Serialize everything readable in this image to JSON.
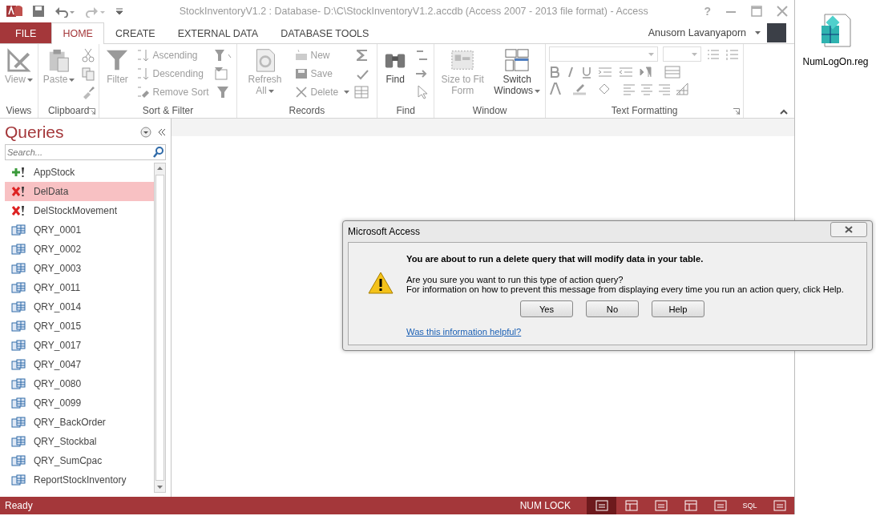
{
  "window": {
    "title": "StockInventoryV1.2 : Database- D:\\C\\StockInventoryV1.2.accdb (Access 2007 - 2013 file format) - Access",
    "help": "?"
  },
  "tabs": [
    {
      "label": "FILE",
      "kind": "file",
      "selected": false
    },
    {
      "label": "HOME",
      "kind": "tab",
      "selected": true
    },
    {
      "label": "CREATE",
      "kind": "tab",
      "selected": false
    },
    {
      "label": "EXTERNAL DATA",
      "kind": "tab",
      "selected": false
    },
    {
      "label": "DATABASE TOOLS",
      "kind": "tab",
      "selected": false
    }
  ],
  "user": {
    "name": "Anusorn Lavanyaporn"
  },
  "ribbon_groups": [
    {
      "label": "Views",
      "launcher": false,
      "commands": [
        {
          "label": "View",
          "kind": "large",
          "caret": true,
          "disabled": true
        }
      ]
    },
    {
      "label": "Clipboard",
      "launcher": true,
      "commands": [
        {
          "label": "Paste",
          "kind": "large",
          "caret": true,
          "disabled": true
        }
      ]
    },
    {
      "label": "Sort & Filter",
      "launcher": false,
      "commands": [
        {
          "label": "Filter",
          "kind": "large",
          "caret": false,
          "disabled": true
        },
        {
          "label": "Ascending",
          "kind": "small",
          "caret": false,
          "disabled": true
        },
        {
          "label": "Descending",
          "kind": "small",
          "caret": false,
          "disabled": true
        },
        {
          "label": "Remove Sort",
          "kind": "small",
          "caret": false,
          "disabled": true
        }
      ]
    },
    {
      "label": "Records",
      "launcher": false,
      "commands": [
        {
          "label": "Refresh All",
          "kind": "large",
          "caret": true,
          "disabled": true
        },
        {
          "label": "New",
          "kind": "small",
          "caret": false,
          "disabled": true
        },
        {
          "label": "Save",
          "kind": "small",
          "caret": false,
          "disabled": true
        },
        {
          "label": "Delete",
          "kind": "small",
          "caret": true,
          "disabled": true
        }
      ]
    },
    {
      "label": "Find",
      "launcher": false,
      "commands": [
        {
          "label": "Find",
          "kind": "large",
          "caret": false,
          "disabled": false
        }
      ]
    },
    {
      "label": "Window",
      "launcher": false,
      "commands": [
        {
          "label": "Size to Fit Form",
          "kind": "large",
          "caret": false,
          "disabled": true
        },
        {
          "label": "Switch Windows",
          "kind": "large",
          "caret": true,
          "disabled": false
        }
      ]
    },
    {
      "label": "Text Formatting",
      "launcher": true
    }
  ],
  "nav": {
    "title": "Queries",
    "search": {
      "placeholder": "Search..."
    },
    "items": [
      {
        "label": "AppStock",
        "kind": "append",
        "selected": false
      },
      {
        "label": "DelData",
        "kind": "delete",
        "selected": true
      },
      {
        "label": "DelStockMovement",
        "kind": "delete",
        "selected": false
      },
      {
        "label": "QRY_0001",
        "kind": "select",
        "selected": false
      },
      {
        "label": "QRY_0002",
        "kind": "select",
        "selected": false
      },
      {
        "label": "QRY_0003",
        "kind": "select",
        "selected": false
      },
      {
        "label": "QRY_0011",
        "kind": "select",
        "selected": false
      },
      {
        "label": "QRY_0014",
        "kind": "select",
        "selected": false
      },
      {
        "label": "QRY_0015",
        "kind": "select",
        "selected": false
      },
      {
        "label": "QRY_0017",
        "kind": "select",
        "selected": false
      },
      {
        "label": "QRY_0047",
        "kind": "select",
        "selected": false
      },
      {
        "label": "QRY_0080",
        "kind": "select",
        "selected": false
      },
      {
        "label": "QRY_0099",
        "kind": "select",
        "selected": false
      },
      {
        "label": "QRY_BackOrder",
        "kind": "select",
        "selected": false
      },
      {
        "label": "QRY_Stockbal",
        "kind": "select",
        "selected": false
      },
      {
        "label": "QRY_SumCpac",
        "kind": "select",
        "selected": false
      },
      {
        "label": "ReportStockInventory",
        "kind": "select",
        "selected": false
      }
    ]
  },
  "dialog": {
    "title": "Microsoft Access",
    "heading": "You are about to run a delete query that will modify data in your table.",
    "lines": [
      "Are you sure you want to run this type of action query?",
      "For information on how to prevent this message from displaying every time you run an action query, click Help."
    ],
    "buttons": [
      "Yes",
      "No",
      "Help"
    ],
    "link": "Was this information helpful?"
  },
  "status_bar": {
    "text": "Ready",
    "indicator": "NUM LOCK",
    "views": [
      {
        "selected": true
      },
      {
        "selected": false
      },
      {
        "selected": false
      },
      {
        "selected": false
      },
      {
        "selected": false
      },
      {
        "label": "SQL",
        "selected": false
      },
      {
        "selected": false
      }
    ]
  },
  "desktop": {
    "icon_label": "NumLogOn.reg"
  }
}
